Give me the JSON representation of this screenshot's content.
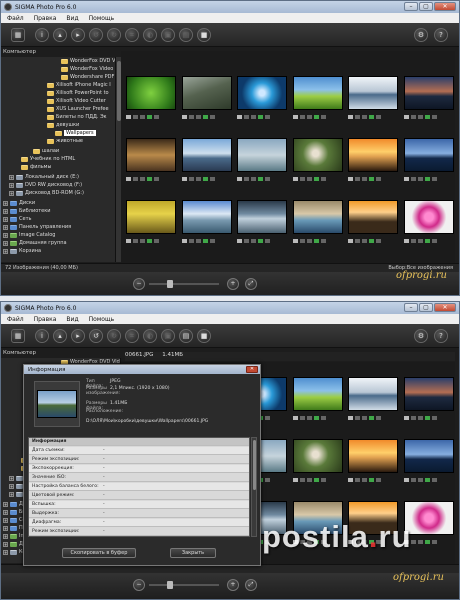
{
  "app": {
    "title": "SIGMA Photo Pro 6.0"
  },
  "window_buttons": {
    "minimize": "–",
    "maximize": "▢",
    "close": "✕"
  },
  "menu": [
    "Файл",
    "Правка",
    "Вид",
    "Помощь"
  ],
  "toolbar_icons": [
    "grid-view-icon",
    "info-icon",
    "upload-icon",
    "play-icon",
    "rotate-left-icon",
    "rotate-right-icon",
    "crop-icon",
    "adjust-icon",
    "save-icon",
    "print-icon",
    "stop-icon",
    "settings-icon",
    "help-icon"
  ],
  "tree": {
    "header": "Компьютер",
    "items": [
      {
        "label": "WonderFox DVD Vide",
        "type": "folder"
      },
      {
        "label": "WonderFox Video Cor",
        "type": "folder"
      },
      {
        "label": "Wondershare PDF Ed",
        "type": "folder"
      },
      {
        "label": "Xilisoft iPhone Magic I",
        "type": "folder"
      },
      {
        "label": "Xilisoft PowerPoint to",
        "type": "folder"
      },
      {
        "label": "Xilisoft Video Cutter",
        "type": "folder"
      },
      {
        "label": "XUS Launcher Prefee",
        "type": "folder"
      },
      {
        "label": "Билеты по ПДД. Эк",
        "type": "folder"
      },
      {
        "label": "девушки",
        "type": "folder"
      },
      {
        "label": "Wallpapers",
        "type": "folder",
        "selected": true
      },
      {
        "label": "животные",
        "type": "folder"
      },
      {
        "label": "шалаи",
        "type": "folder"
      },
      {
        "label": "Учебник по HTML",
        "type": "folder"
      },
      {
        "label": "фильмы",
        "type": "folder"
      },
      {
        "label": "Локальный диск (E:)",
        "type": "drive"
      },
      {
        "label": "DVD RW дисковод (F:)",
        "type": "drive"
      },
      {
        "label": "Дисковод BD-ROM (G:)",
        "type": "drive"
      },
      {
        "label": "Диски",
        "type": "blue"
      },
      {
        "label": "Библиотеки",
        "type": "blue"
      },
      {
        "label": "Сеть",
        "type": "blue"
      },
      {
        "label": "Панель управления",
        "type": "blue"
      },
      {
        "label": "Image Catalog",
        "type": "green"
      },
      {
        "label": "Домашняя группа",
        "type": "green"
      },
      {
        "label": "Корзина",
        "type": "drive"
      }
    ]
  },
  "status": {
    "left": "72 Изображения (40,00 МБ)",
    "right": "Выбор:Все изображения"
  },
  "watermark_top": "ofprogi.ru",
  "info_header": {
    "file": "00661.JPG",
    "size": "1.41МБ"
  },
  "dialog": {
    "title": "Информация",
    "props": [
      {
        "k": "Тип файла:",
        "v": "JPEG"
      },
      {
        "k": "Размеры изображения:",
        "v": "2,1 Мпикс. (1920 x 1080)"
      },
      {
        "k": "Размеры файла:",
        "v": "1.41МБ"
      },
      {
        "k": "Расположение:",
        "v": "D:\\ОЛЯ\\Мои\\коробки\\девушки\\Wallpapers\\00661.JPG"
      }
    ],
    "table_rows": [
      {
        "k": "Информация",
        "v": ""
      },
      {
        "k": "Дата съемки:",
        "v": "-"
      },
      {
        "k": "Режим экспозиции:",
        "v": "-"
      },
      {
        "k": "Экспокоррекция:",
        "v": "-"
      },
      {
        "k": "Значение ISO:",
        "v": "-"
      },
      {
        "k": "Настройка баланса белого:",
        "v": "-"
      },
      {
        "k": "Цветовой режим:",
        "v": "-"
      },
      {
        "k": "Вспышка:",
        "v": "-"
      },
      {
        "k": "Выдержка:",
        "v": "-"
      },
      {
        "k": "Диафрагма:",
        "v": "-"
      },
      {
        "k": "Режим экспозиции:",
        "v": "-"
      }
    ],
    "copy_button": "Скопировать в буфер",
    "close_button": "Закрыть"
  },
  "watermark_bottom": {
    "text": "postila",
    "dot": ".",
    "tld": "ru"
  },
  "colors": {
    "accent_gold": "#e8c25a",
    "background": "#1d1d1d",
    "rating_green": "#3fa848"
  }
}
